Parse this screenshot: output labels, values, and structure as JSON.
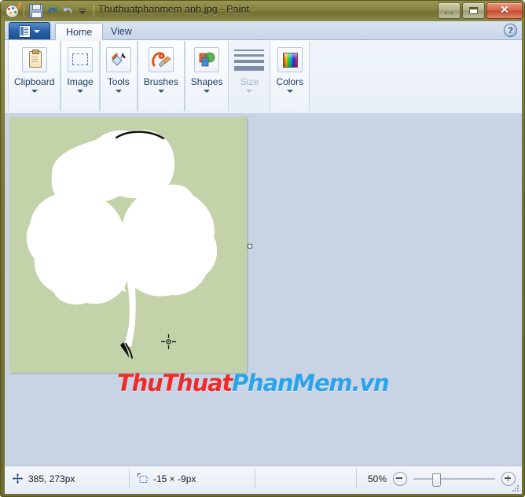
{
  "window": {
    "title": "Thuthuatphanmem anh.jpg - Paint",
    "app_icon": "paint-logo-icon",
    "quick_access": [
      {
        "name": "save-icon",
        "label": "Save"
      },
      {
        "name": "undo-icon",
        "label": "Undo"
      },
      {
        "name": "redo-icon",
        "label": "Redo"
      },
      {
        "name": "customize-quick-access-icon",
        "label": "Customize Quick Access Toolbar"
      }
    ],
    "controls": {
      "minimize": "Minimize",
      "maximize": "Maximize",
      "close": "Close",
      "close_glyph": "✕"
    }
  },
  "ribbon": {
    "app_button_label": "File",
    "tabs": [
      {
        "label": "Home",
        "active": true
      },
      {
        "label": "View",
        "active": false
      }
    ],
    "help_glyph": "?",
    "help_label": "Help",
    "groups": [
      {
        "label": "Clipboard",
        "icon": "clipboard-icon",
        "disabled": false,
        "caret": true
      },
      {
        "label": "Image",
        "icon": "select-rectangle-icon",
        "disabled": false,
        "caret": true
      },
      {
        "label": "Tools",
        "icon": "paint-bucket-icon",
        "disabled": false,
        "caret": true
      },
      {
        "label": "Brushes",
        "icon": "brush-icon",
        "disabled": false,
        "caret": true
      },
      {
        "label": "Shapes",
        "icon": "shapes-icon",
        "disabled": false,
        "caret": true
      },
      {
        "label": "Size",
        "icon": "size-lines-icon",
        "disabled": true,
        "caret": true
      },
      {
        "label": "Colors",
        "icon": "color-palette-icon",
        "disabled": false,
        "caret": true
      }
    ]
  },
  "canvas": {
    "background_color": "#c3d2a9",
    "shape_color": "#ffffff",
    "shape_name": "clover-leaf-drawing",
    "cursor": "crosshair-cursor",
    "resize_handle": "canvas-resize-handle-right"
  },
  "watermark": {
    "part1": "ThuThuat",
    "part2": "PhanMem.vn",
    "color1": "#ee2b2b",
    "color2": "#2aa3e8"
  },
  "statusbar": {
    "cursor_position": "385, 273px",
    "selection_size": "-15 × -9px",
    "zoom_level": "50%",
    "zoom_out_label": "Zoom out",
    "zoom_in_label": "Zoom in",
    "position_icon": "cursor-position-icon",
    "selection_icon": "selection-size-icon"
  }
}
